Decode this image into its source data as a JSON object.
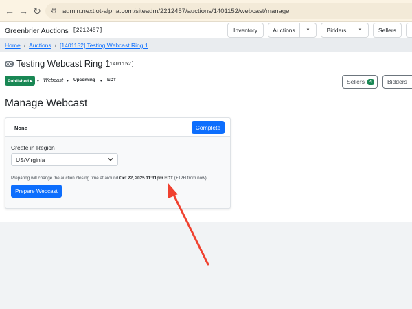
{
  "browser": {
    "url": "admin.nextlot-alpha.com/siteadm/2212457/auctions/1401152/webcast/manage",
    "back_icon": "arrow-left-icon",
    "forward_icon": "arrow-right-icon",
    "reload_icon": "reload-icon",
    "site_settings_icon": "tune-icon"
  },
  "header": {
    "title": "Greenbrier Auctions",
    "site_id": "[2212457]",
    "buttons": {
      "inventory": "Inventory",
      "auctions": "Auctions",
      "bidders": "Bidders",
      "sellers": "Sellers"
    }
  },
  "breadcrumb": {
    "items": [
      "Home",
      "Auctions",
      "[1401152] Testing Webcast Ring 1"
    ],
    "separator": "/"
  },
  "auction": {
    "name": "Testing Webcast Ring 1",
    "id": "[1401152]",
    "status": "Published ▸",
    "type": "Webcast",
    "timing": "Upcoming",
    "timezone": "EDT",
    "sellers_label": "Sellers",
    "sellers_count": "4",
    "bidders_label": "Bidders"
  },
  "page": {
    "title": "Manage Webcast"
  },
  "webcast_card": {
    "status": "None",
    "complete_button": "Complete",
    "region_label": "Create in Region",
    "region_value": "US/Virginia",
    "note_prefix": "Preparing will change the auction closing time at around",
    "note_time": "Oct 22, 2025 11:31pm EDT",
    "note_suffix": "(+12H from now)",
    "prepare_button": "Prepare Webcast"
  },
  "colors": {
    "primary": "#0d6efd",
    "success": "#198754",
    "annotation_arrow": "#f0412f"
  }
}
